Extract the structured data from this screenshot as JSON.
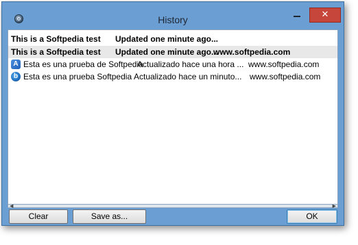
{
  "window": {
    "title": "History",
    "close_glyph": "✕",
    "accent_color": "#6b9fd4",
    "close_color": "#c7463c"
  },
  "history": {
    "rows": [
      {
        "style": "bold",
        "icon": "",
        "col1": "This is a Softpedia test",
        "col2": "Updated one minute ago...",
        "col3": ""
      },
      {
        "style": "bold",
        "icon": "",
        "col1": "This is a Softpedia test",
        "col2": "Updated one minute ago...",
        "col3": "www.softpedia.com"
      },
      {
        "style": "normal",
        "icon": "translate-icon",
        "icon_glyph": "A",
        "col1": "Esta es una prueba de Softpedia",
        "col2": "Actualizado hace una hora ...",
        "col3": "www.softpedia.com"
      },
      {
        "style": "normal",
        "icon": "bing-icon",
        "icon_glyph": "b",
        "col1": "Esta es una prueba Softpedia",
        "col2": "Actualizado hace un minuto...",
        "col3": "www.softpedia.com"
      }
    ]
  },
  "buttons": {
    "clear": "Clear",
    "save_as": "Save as...",
    "ok": "OK"
  },
  "scrollbar": {
    "left_arrow": "◀",
    "right_arrow": "▶"
  }
}
